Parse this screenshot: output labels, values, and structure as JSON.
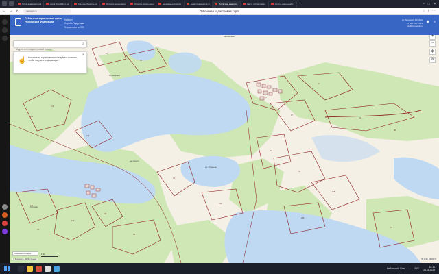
{
  "browser": {
    "tabs": [
      {
        "label": "Публичная кадастровая к",
        "active": false
      },
      {
        "label": "карта Луга 2024 и на карте",
        "active": false
      },
      {
        "label": "куда как обновить описание",
        "active": false
      },
      {
        "label": "Отделка склона деревья",
        "active": false
      },
      {
        "label": "Отделка склона деревья",
        "active": false
      },
      {
        "label": "деревянные подсобн",
        "active": false
      },
      {
        "label": "кадастровая карта публи",
        "active": false
      },
      {
        "label": "Публичная кадастро",
        "active": true
      },
      {
        "label": "Шесть соб ветхового уч",
        "active": false
      },
      {
        "label": "Купить земельный уч",
        "active": false
      }
    ],
    "url": "nspd.gov.ru",
    "page_title": "Публичная кадастровая карта"
  },
  "site": {
    "org_name": "Публичная кадастровая карта Российской Федерации",
    "links": [
      "Кабинет",
      "Служба Поддержки",
      "Справочная по ЗКП"
    ],
    "contact_line1": "ул.Лиговский 12/31 кв",
    "contact_line2": "8 800 100 34 34",
    "contact_line3": "info@rosreestr.ru"
  },
  "map": {
    "search_placeholder": "Адрес или кадастровый номер",
    "hint_text": "Кликните по карте или воспользуйтесь поиском, чтобы получить информацию.",
    "place_labels": [
      "Малиновка",
      "Поляшкино",
      "оз. Озеро",
      "оз. Ильмень",
      "Луговая"
    ],
    "parcel_numbers": [
      "114",
      "116",
      "119",
      "121",
      "132",
      "48",
      "13",
      "39",
      "12",
      "97",
      "3",
      "40",
      "31",
      "15",
      "108",
      "216",
      "72",
      "94",
      "11",
      "120",
      "88",
      "45"
    ],
    "legend_label": "Проекция по карте",
    "scale_label": "1 км",
    "copyright": "© Росреестр, 2024 | Яндекс",
    "coords": "59.0742, 29.8315"
  },
  "taskbar": {
    "weather": "Небольшой Снег",
    "lang": "РУС",
    "time": "14:12",
    "date": "21.11.2024"
  },
  "colors": {
    "water": "#bfd9f3",
    "forest": "#cfe6b5",
    "land": "#f4f0e6",
    "parcel_border": "#8b1d1d",
    "header": "#3766c4"
  }
}
